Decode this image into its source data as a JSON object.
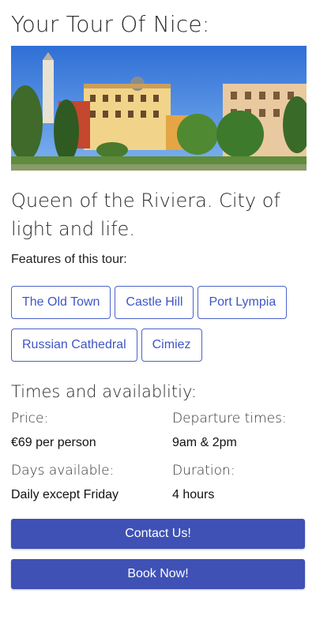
{
  "page": {
    "title": "Your Tour Of Nice:",
    "tagline": "Queen of the Riviera. City of light and life.",
    "features_label": "Features of this tour:"
  },
  "features": [
    "The Old Town",
    "Castle Hill",
    "Port Lympia",
    "Russian Cathedral",
    "Cimiez"
  ],
  "times": {
    "heading": "Times and availablitiy:",
    "price_label": "Price:",
    "price_value": "€69 per person",
    "departure_label": "Departure times:",
    "departure_value": "9am & 2pm",
    "days_label": "Days available:",
    "days_value": "Daily except Friday",
    "duration_label": "Duration:",
    "duration_value": "4 hours"
  },
  "actions": {
    "contact_label": "Contact Us!",
    "book_label": "Book Now!"
  },
  "colors": {
    "accent": "#3f51b5",
    "chip_border": "#4a62c9"
  }
}
